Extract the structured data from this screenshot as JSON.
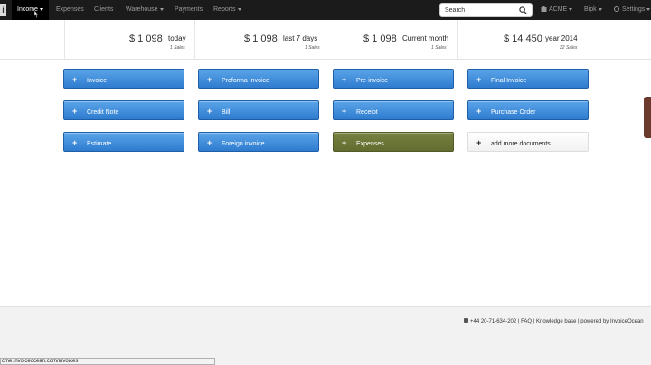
{
  "nav": {
    "logo": "i",
    "items": [
      {
        "label": "Income",
        "active": true
      },
      {
        "label": "Expenses"
      },
      {
        "label": "Clients"
      },
      {
        "label": "Warehouse"
      },
      {
        "label": "Payments"
      },
      {
        "label": "Reports"
      }
    ],
    "search_placeholder": "Search",
    "account": "ACME",
    "user": "Bipk",
    "settings": "Settings"
  },
  "stats": [
    {
      "amount": "$ 1 098",
      "period": "today",
      "sales": "1 Sales"
    },
    {
      "amount": "$ 1 098",
      "period": "last 7 days",
      "sales": "1 Sales"
    },
    {
      "amount": "$ 1 098",
      "period": "Current month",
      "sales": "1 Sales"
    },
    {
      "amount": "$ 14 450",
      "period": "year 2014",
      "sales": "22 Sales"
    }
  ],
  "documents": {
    "row1": [
      "Invoice",
      "Proforma Invoice",
      "Pre-invoice",
      "Final Invoice"
    ],
    "row2": [
      "Credit Note",
      "Bill",
      "Receipt",
      "Purchase Order"
    ],
    "row3": [
      "Estimate",
      "Foreign invoice",
      "Expenses",
      "add more documents"
    ],
    "plus": "+"
  },
  "footer": {
    "text": "+44 20-71-634-202 | FAQ | Knowledge base | powered by InvoiceOcean"
  },
  "statusbar": {
    "url": "cme.invoiceocean.com/invoices"
  },
  "colors": {
    "nav_bg": "#1b1b1b",
    "button_blue": "#3a86d6",
    "button_olive": "#6b7536"
  }
}
